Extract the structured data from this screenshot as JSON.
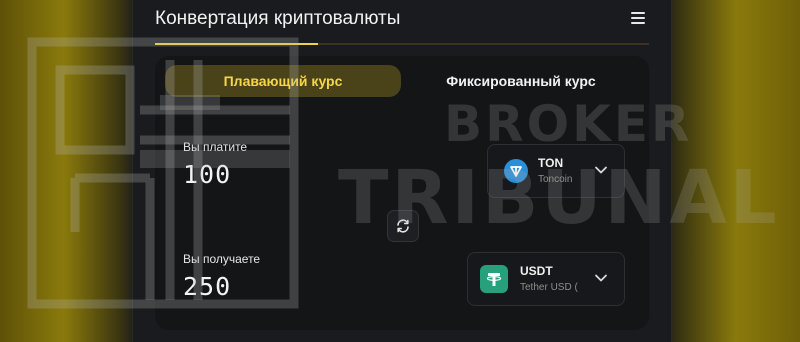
{
  "app": {
    "title": "Конвертация криптовалюты",
    "progress_fraction": 0.33
  },
  "tabs": [
    {
      "label": "Плавающий курс",
      "active": true
    },
    {
      "label": "Фиксированный курс",
      "active": false
    }
  ],
  "send": {
    "label": "Вы платите",
    "amount": "100",
    "coin": {
      "symbol": "TON",
      "name": "Toncoin",
      "icon": "ton-icon"
    }
  },
  "receive": {
    "label": "Вы получаете",
    "amount": "250",
    "coin": {
      "symbol": "USDT",
      "name": "Tether USD (",
      "icon": "tether-icon"
    }
  },
  "watermark": {
    "line1": "BROKER",
    "line2": "TRIBUNAL"
  },
  "colors": {
    "accent": "#f5d84a",
    "panel": "#1a1b1e",
    "ton": "#2a8fd8",
    "tether": "#26a17b"
  }
}
